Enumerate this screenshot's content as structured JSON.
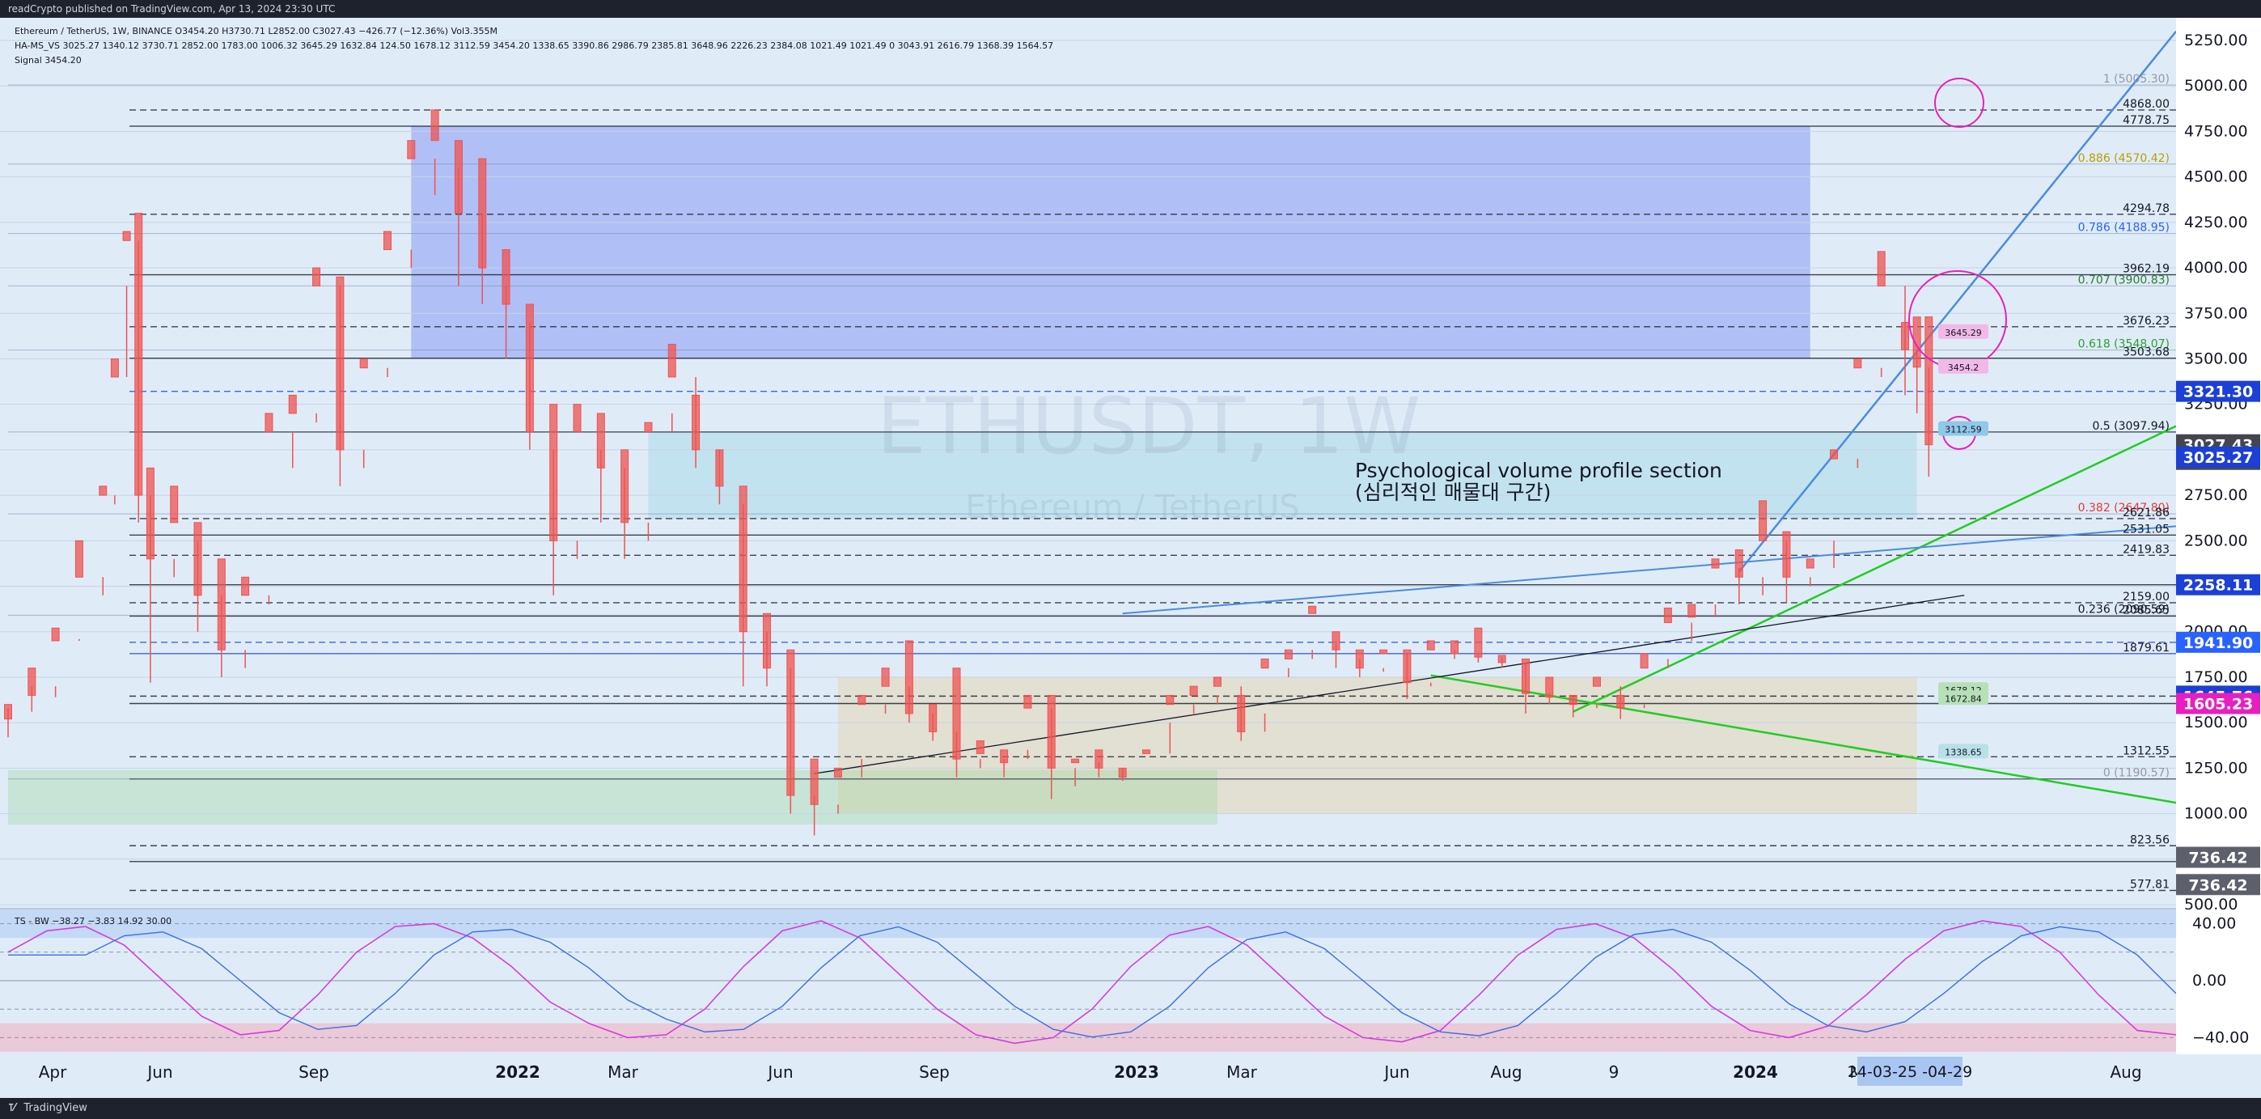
{
  "header": {
    "published": "readCrypto published on TradingView.com, Apr 13, 2024 23:30 UTC"
  },
  "legend": {
    "line1": "Ethereum / TetherUS, 1W, BINANCE  O3454.20  H3730.71  L2852.00  C3027.43  −426.77 (−12.36%)  Vol3.355M",
    "line2": "HA-MS_VS  3025.27  1340.12  3730.71  2852.00  1783.00  1006.32  3645.29  1632.84  124.50  1678.12  3112.59  3454.20  1338.65  3390.86  2986.79  2385.81  3648.96  2226.23  2384.08  1021.49  1021.49  0  3043.91  2616.79  1368.39  1564.57",
    "line3": "Signal  3454.20"
  },
  "watermark": {
    "symbol": "ETHUSDT, 1W",
    "name": "Ethereum / TetherUS"
  },
  "annotation": {
    "line1": "Psychological volume profile section",
    "line2": "(심리적인 매물대 구간)"
  },
  "footer": {
    "brand": "TradingView"
  },
  "price_axis": {
    "ticks": [
      "5250.00",
      "5000.00",
      "4750.00",
      "4500.00",
      "4250.00",
      "4000.00",
      "3750.00",
      "3500.00",
      "3250.00",
      "3000.00",
      "2750.00",
      "2500.00",
      "2250.00",
      "2000.00",
      "1750.00",
      "1500.00",
      "1250.00",
      "1000.00",
      "750.00",
      "500.00"
    ],
    "tags": [
      {
        "label": "3321.30",
        "price": 3321.3,
        "color": "#1c3fd6"
      },
      {
        "label": "3027.43",
        "sub": "1d 1h",
        "price": 3027.43,
        "color": "#434651"
      },
      {
        "label": "3025.27",
        "price": 2960,
        "color": "#1c3fd6"
      },
      {
        "label": "2258.11",
        "price": 2258.11,
        "color": "#1c3fd6"
      },
      {
        "label": "1941.90",
        "price": 1941.9,
        "color": "#2962ff"
      },
      {
        "label": "1645.76",
        "price": 1645.76,
        "color": "#1c3fd6"
      },
      {
        "label": "1605.23",
        "price": 1605.23,
        "color": "#e91ec0"
      },
      {
        "label": "736.42",
        "price": 760,
        "color": "#5d606b"
      },
      {
        "label": "736.42",
        "price": 610,
        "color": "#5d606b"
      }
    ]
  },
  "level_labels": [
    {
      "text": "1 (5005.30)",
      "price": 5005.3,
      "color": "#9598a1"
    },
    {
      "text": "4868.00",
      "price": 4868,
      "color": "#131722"
    },
    {
      "text": "4778.75",
      "price": 4778.75,
      "color": "#131722"
    },
    {
      "text": "0.886 (4570.42)",
      "price": 4570.42,
      "color": "#b8a000"
    },
    {
      "text": "4294.78",
      "price": 4294.78,
      "color": "#131722"
    },
    {
      "text": "0.786 (4188.95)",
      "price": 4188.95,
      "color": "#2962ff"
    },
    {
      "text": "3962.19",
      "price": 3962.19,
      "color": "#131722"
    },
    {
      "text": "0.707 (3900.83)",
      "price": 3900.83,
      "color": "#2e7d32"
    },
    {
      "text": "3676.23",
      "price": 3676.23,
      "color": "#131722"
    },
    {
      "text": "0.618 (3548.07)",
      "price": 3548.07,
      "color": "#2e9e2e"
    },
    {
      "text": "3503.68",
      "price": 3503.68,
      "color": "#131722"
    },
    {
      "text": "0.5 (3097.94)",
      "price": 3097.94,
      "color": "#131722"
    },
    {
      "text": "0.382 (2647.80)",
      "price": 2647.8,
      "color": "#e53935"
    },
    {
      "text": "2621.86",
      "price": 2621.86,
      "color": "#131722"
    },
    {
      "text": "2531.05",
      "price": 2531.05,
      "color": "#131722"
    },
    {
      "text": "2419.83",
      "price": 2419.83,
      "color": "#131722"
    },
    {
      "text": "2159.00",
      "price": 2159,
      "color": "#131722"
    },
    {
      "text": "0.236 (2090.59)",
      "price": 2090.59,
      "color": "#131722"
    },
    {
      "text": "2085.65",
      "price": 2085.65,
      "color": "#131722"
    },
    {
      "text": "1879.61",
      "price": 1879.61,
      "color": "#131722"
    },
    {
      "text": "1312.55",
      "price": 1312.55,
      "color": "#131722"
    },
    {
      "text": "0 (1190.57)",
      "price": 1190.57,
      "color": "#9598a1"
    },
    {
      "text": "823.56",
      "price": 823.56,
      "color": "#131722"
    },
    {
      "text": "577.81",
      "price": 577.81,
      "color": "#131722"
    }
  ],
  "box_tags": [
    {
      "text": "3645.29",
      "price": 3645.29,
      "color": "#f2b8e6"
    },
    {
      "text": "3454.2",
      "price": 3454.2,
      "color": "#f2b8e6"
    },
    {
      "text": "3112.59",
      "price": 3112.59,
      "color": "#90c8e8"
    },
    {
      "text": "1678.12",
      "price": 1678.12,
      "color": "#b8e0b8"
    },
    {
      "text": "1672.84",
      "price": 1632.84,
      "color": "#b8e0b8"
    },
    {
      "text": "1338.65",
      "price": 1338.65,
      "color": "#b8e0e8"
    }
  ],
  "indicator": {
    "label": "TS - BW  −38.27  −3.83  14.92  30.00",
    "ticks": [
      "40.00",
      "0.00",
      "−40.00"
    ]
  },
  "time_axis": {
    "labels": [
      "Apr",
      "Jun",
      "Sep",
      "2022",
      "Mar",
      "Jun",
      "Sep",
      "2023",
      "Mar",
      "Jun",
      "Aug",
      "9",
      "2024",
      "M",
      "Aug"
    ],
    "cursor_box": "24-03-25  -04-29"
  },
  "chart_data": {
    "type": "candlestick",
    "title": "ETHUSDT, 1W",
    "ylim": [
      500,
      5250
    ],
    "x_range": [
      "2021-03",
      "2024-09"
    ],
    "last_close": 3027.43,
    "ohlc": [
      [
        "2021-03-01",
        1600,
        1580,
        1420,
        1520
      ],
      [
        "2021-03-15",
        1800,
        1700,
        1560,
        1650
      ],
      [
        "2021-03-29",
        2020,
        1700,
        1640,
        1950
      ],
      [
        "2021-04-12",
        2500,
        1950,
        1960,
        2300
      ],
      [
        "2021-04-26",
        2800,
        2300,
        2200,
        2750
      ],
      [
        "2021-05-03",
        3500,
        2750,
        2700,
        3400
      ],
      [
        "2021-05-10",
        4200,
        3400,
        3900,
        4150
      ],
      [
        "2021-05-17",
        4300,
        4150,
        2600,
        2750
      ],
      [
        "2021-05-24",
        2900,
        2750,
        1720,
        2400
      ],
      [
        "2021-06-07",
        2800,
        2400,
        2300,
        2600
      ],
      [
        "2021-06-21",
        2600,
        2500,
        2000,
        2200
      ],
      [
        "2021-07-05",
        2400,
        2200,
        1750,
        1900
      ],
      [
        "2021-07-19",
        2300,
        1900,
        1800,
        2200
      ],
      [
        "2021-08-02",
        3200,
        2200,
        2150,
        3100
      ],
      [
        "2021-08-16",
        3300,
        3100,
        2900,
        3200
      ],
      [
        "2021-08-30",
        4000,
        3200,
        3150,
        3900
      ],
      [
        "2021-09-13",
        3950,
        3900,
        2800,
        3000
      ],
      [
        "2021-09-27",
        3500,
        3000,
        2900,
        3450
      ],
      [
        "2021-10-11",
        4200,
        3450,
        3400,
        4100
      ],
      [
        "2021-10-25",
        4700,
        4100,
        4000,
        4600
      ],
      [
        "2021-11-08",
        4868,
        4600,
        4400,
        4700
      ],
      [
        "2021-11-22",
        4700,
        4550,
        3900,
        4300
      ],
      [
        "2021-12-06",
        4600,
        4300,
        3800,
        4000
      ],
      [
        "2021-12-20",
        4100,
        3900,
        3500,
        3800
      ],
      [
        "2022-01-03",
        3800,
        3700,
        3000,
        3100
      ],
      [
        "2022-01-17",
        3250,
        3000,
        2200,
        2500
      ],
      [
        "2022-01-31",
        3250,
        2500,
        2400,
        3100
      ],
      [
        "2022-02-14",
        3200,
        3000,
        2600,
        2900
      ],
      [
        "2022-02-28",
        3000,
        2900,
        2400,
        2600
      ],
      [
        "2022-03-14",
        3150,
        2600,
        2500,
        3100
      ],
      [
        "2022-03-28",
        3580,
        3100,
        3200,
        3400
      ],
      [
        "2022-04-11",
        3300,
        3400,
        2900,
        3000
      ],
      [
        "2022-04-25",
        3000,
        3000,
        2700,
        2800
      ],
      [
        "2022-05-09",
        2800,
        2700,
        1700,
        2000
      ],
      [
        "2022-05-23",
        2100,
        2000,
        1700,
        1800
      ],
      [
        "2022-06-06",
        1900,
        1800,
        1000,
        1100
      ],
      [
        "2022-06-20",
        1300,
        1100,
        880,
        1050
      ],
      [
        "2022-07-04",
        1250,
        1050,
        1000,
        1200
      ],
      [
        "2022-07-18",
        1650,
        1200,
        1300,
        1600
      ],
      [
        "2022-08-01",
        1800,
        1600,
        1550,
        1700
      ],
      [
        "2022-08-15",
        1950,
        1700,
        1500,
        1550
      ],
      [
        "2022-08-29",
        1600,
        1550,
        1400,
        1450
      ],
      [
        "2022-09-12",
        1800,
        1450,
        1200,
        1300
      ],
      [
        "2022-09-26",
        1400,
        1300,
        1250,
        1330
      ],
      [
        "2022-10-10",
        1350,
        1300,
        1200,
        1280
      ],
      [
        "2022-10-24",
        1650,
        1300,
        1350,
        1580
      ],
      [
        "2022-11-07",
        1650,
        1580,
        1080,
        1250
      ],
      [
        "2022-11-21",
        1300,
        1250,
        1150,
        1280
      ],
      [
        "2022-12-05",
        1350,
        1280,
        1200,
        1250
      ],
      [
        "2022-12-19",
        1250,
        1250,
        1180,
        1200
      ],
      [
        "2023-01-02",
        1350,
        1200,
        1200,
        1330
      ],
      [
        "2023-01-16",
        1650,
        1330,
        1500,
        1600
      ],
      [
        "2023-01-30",
        1700,
        1600,
        1550,
        1650
      ],
      [
        "2023-02-13",
        1750,
        1650,
        1600,
        1700
      ],
      [
        "2023-02-27",
        1650,
        1700,
        1400,
        1450
      ],
      [
        "2023-03-13",
        1850,
        1450,
        1550,
        1800
      ],
      [
        "2023-03-27",
        1900,
        1800,
        1750,
        1850
      ],
      [
        "2023-04-10",
        2140,
        1850,
        1900,
        2100
      ],
      [
        "2023-04-24",
        2000,
        1950,
        1800,
        1900
      ],
      [
        "2023-05-08",
        1900,
        1850,
        1750,
        1800
      ],
      [
        "2023-05-22",
        1900,
        1800,
        1780,
        1880
      ],
      [
        "2023-06-05",
        1900,
        1880,
        1630,
        1720
      ],
      [
        "2023-06-19",
        1950,
        1720,
        1700,
        1900
      ],
      [
        "2023-07-03",
        1950,
        1900,
        1850,
        1880
      ],
      [
        "2023-07-17",
        2020,
        1880,
        1830,
        1860
      ],
      [
        "2023-07-31",
        1870,
        1860,
        1800,
        1830
      ],
      [
        "2023-08-14",
        1850,
        1830,
        1550,
        1660
      ],
      [
        "2023-08-28",
        1750,
        1660,
        1600,
        1640
      ],
      [
        "2023-09-11",
        1650,
        1640,
        1530,
        1600
      ],
      [
        "2023-09-25",
        1750,
        1600,
        1580,
        1700
      ],
      [
        "2023-10-09",
        1650,
        1700,
        1520,
        1580
      ],
      [
        "2023-10-23",
        1880,
        1580,
        1600,
        1800
      ],
      [
        "2023-11-06",
        2130,
        1800,
        1850,
        2050
      ],
      [
        "2023-11-20",
        2150,
        2050,
        1950,
        2080
      ],
      [
        "2023-12-04",
        2400,
        2080,
        2150,
        2350
      ],
      [
        "2023-12-18",
        2450,
        2350,
        2150,
        2300
      ],
      [
        "2024-01-01",
        2720,
        2300,
        2200,
        2500
      ],
      [
        "2024-01-15",
        2550,
        2500,
        2160,
        2300
      ],
      [
        "2024-01-29",
        2400,
        2300,
        2250,
        2350
      ],
      [
        "2024-02-12",
        3000,
        2350,
        2500,
        2950
      ],
      [
        "2024-02-26",
        3500,
        2950,
        2900,
        3450
      ],
      [
        "2024-03-11",
        4090,
        3450,
        3400,
        3900
      ],
      [
        "2024-03-25",
        3700,
        3900,
        3300,
        3550
      ],
      [
        "2024-04-01",
        3730,
        3550,
        3200,
        3454.2
      ],
      [
        "2024-04-08",
        3730.71,
        3454.2,
        2852,
        3027.43
      ]
    ],
    "horizontal_levels": [
      4868,
      4778.75,
      4294.78,
      3962.19,
      3676.23,
      3503.68,
      3321.3,
      3097.94,
      2621.86,
      2531.05,
      2419.83,
      2258.11,
      2159,
      2085.65,
      1941.9,
      1879.61,
      1645.76,
      1605.23,
      1312.55,
      1190.57,
      823.56,
      736.42,
      577.81
    ],
    "fib_levels": [
      {
        "ratio": 1,
        "price": 5005.3
      },
      {
        "ratio": 0.886,
        "price": 4570.42
      },
      {
        "ratio": 0.786,
        "price": 4188.95
      },
      {
        "ratio": 0.707,
        "price": 3900.83
      },
      {
        "ratio": 0.618,
        "price": 3548.07
      },
      {
        "ratio": 0.5,
        "price": 3097.94
      },
      {
        "ratio": 0.382,
        "price": 2647.8
      },
      {
        "ratio": 0.236,
        "price": 2090.59
      },
      {
        "ratio": 0,
        "price": 1190.57
      }
    ],
    "zones": [
      {
        "from": "2021-10-25",
        "to": "2024-01-29",
        "low": 3500,
        "high": 4778.75,
        "color": "#5b6cf5"
      },
      {
        "from": "2022-03-14",
        "to": "2024-04-01",
        "low": 2620,
        "high": 3100,
        "color": "#8fd1e0"
      },
      {
        "from": "2022-07-04",
        "to": "2024-04-01",
        "low": 1000,
        "high": 1750,
        "color": "#e8c98f"
      },
      {
        "from": "2021-03-01",
        "to": "2023-02-13",
        "low": 940,
        "high": 1240,
        "color": "#9ad69a"
      }
    ],
    "indicator_series": {
      "name": "TS - BW",
      "ylim": [
        -50,
        50
      ],
      "values": [
        20,
        35,
        38,
        25,
        0,
        -25,
        -38,
        -35,
        -10,
        20,
        38,
        40,
        30,
        10,
        -15,
        -30,
        -40,
        -38,
        -20,
        10,
        35,
        42,
        30,
        5,
        -20,
        -38,
        -44,
        -40,
        -20,
        10,
        32,
        38,
        25,
        0,
        -25,
        -40,
        -43,
        -35,
        -10,
        18,
        36,
        40,
        30,
        8,
        -18,
        -35,
        -40,
        -32,
        -10,
        15,
        35,
        42,
        38,
        20,
        -10,
        -35,
        -38
      ]
    }
  }
}
